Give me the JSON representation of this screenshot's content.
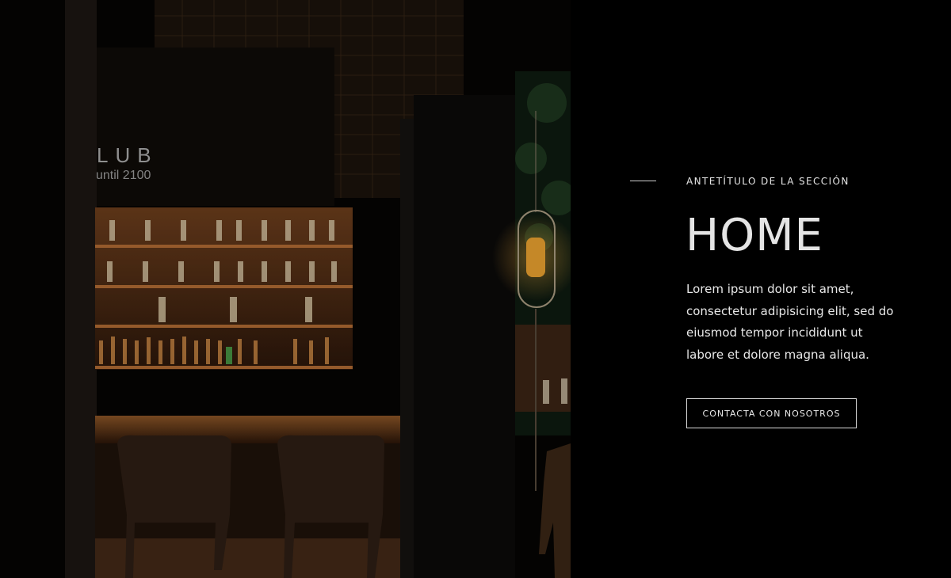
{
  "hero_image": {
    "alt": "Dark bar interior with lit liquor shelves, pendant lamp and chairs",
    "sign_text": "LUB",
    "sign_subtext": "until 2100"
  },
  "section": {
    "eyebrow": "ANTETÍTULO DE LA SECCIÓN",
    "title": "HOME",
    "description": "Lorem ipsum dolor sit amet, consectetur adipisicing elit, sed do eiusmod tempor incididunt ut labore et dolore magna aliqua.",
    "cta_label": "CONTACTA CON NOSOTROS"
  },
  "colors": {
    "background": "#000000",
    "text": "#e8e8e8",
    "amber_light": "#c2773c"
  }
}
